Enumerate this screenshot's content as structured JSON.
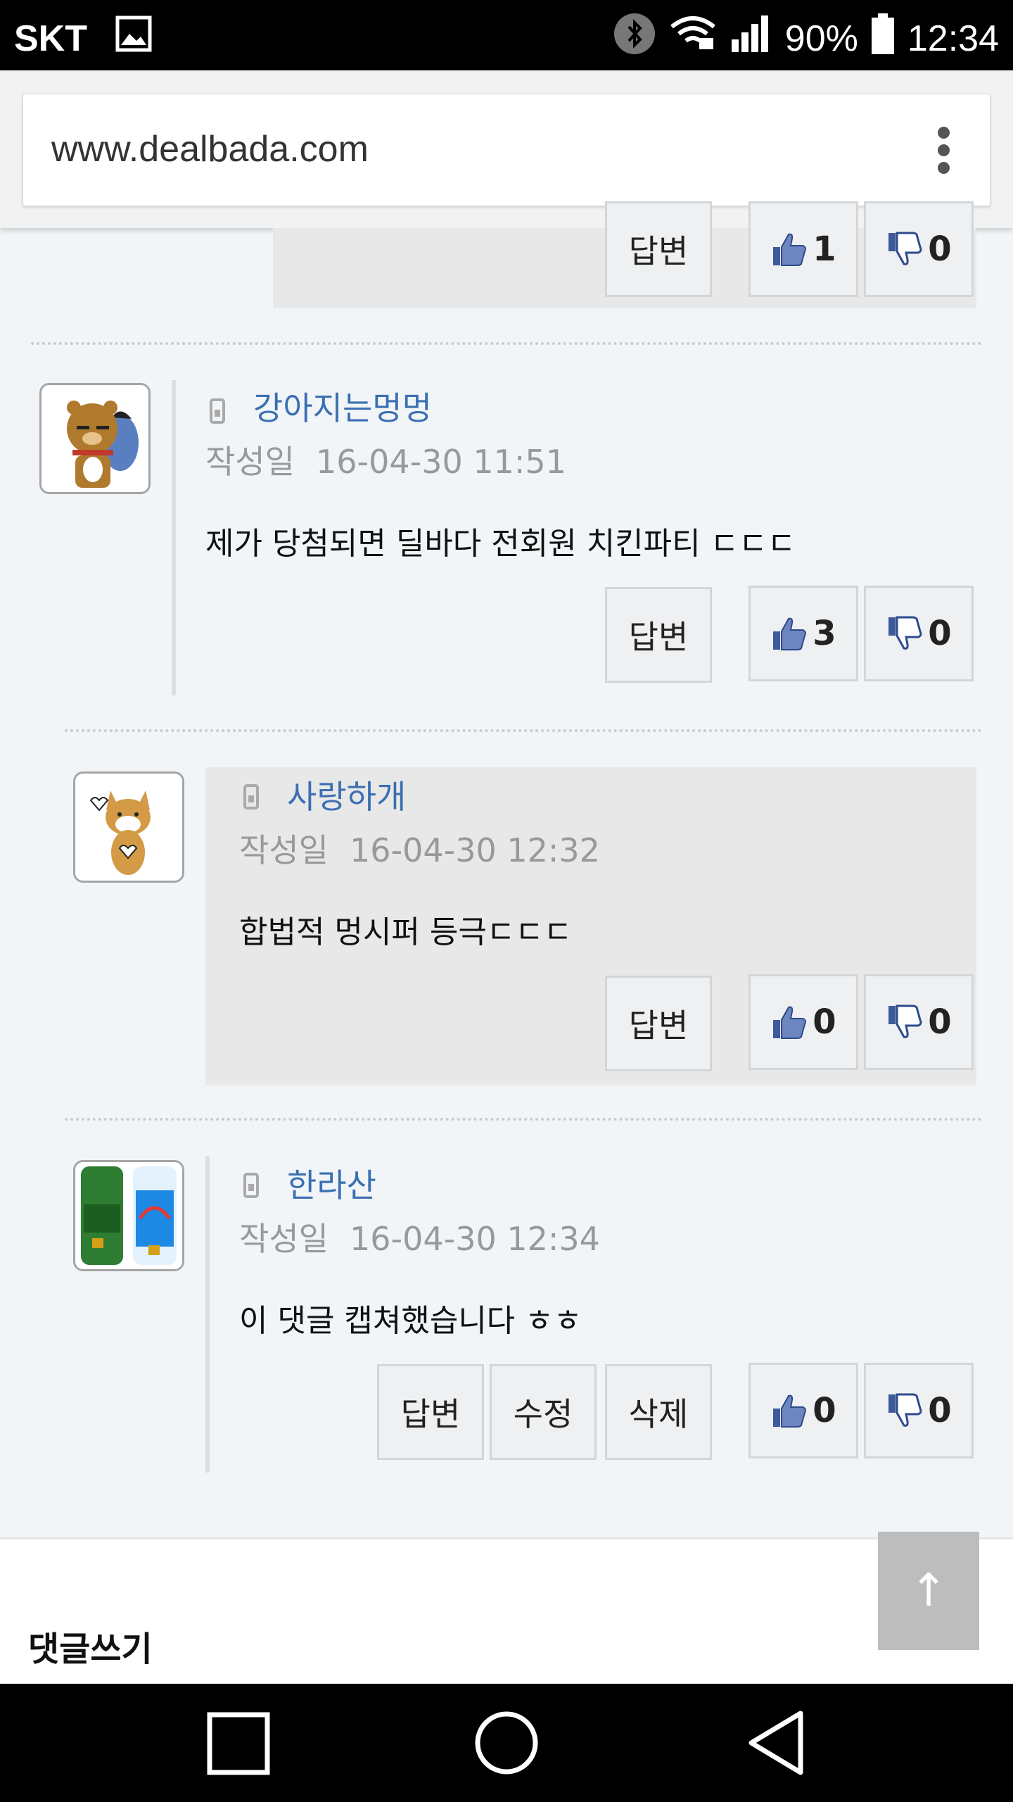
{
  "status": {
    "carrier": "SKT",
    "battery": "90%",
    "time": "12:34"
  },
  "browser": {
    "url": "www.dealbada.com"
  },
  "labels": {
    "written": "작성일",
    "reply": "답변",
    "edit": "수정",
    "delete": "삭제"
  },
  "prev_comment": {
    "likes": "1",
    "dislikes": "0"
  },
  "comments": [
    {
      "author": "강아지는멍멍",
      "date": "16-04-30 11:51",
      "text": "제가 당첨되면 딜바다 전회원 치킨파티 ㄷㄷㄷ",
      "likes": "3",
      "dislikes": "0"
    },
    {
      "author": "사랑하개",
      "date": "16-04-30 12:32",
      "text": "합법적 멍시퍼 등극ㄷㄷㄷ",
      "likes": "0",
      "dislikes": "0"
    },
    {
      "author": "한라산",
      "date": "16-04-30 12:34",
      "text": "이 댓글 캡쳐했습니다 ㅎㅎ",
      "likes": "0",
      "dislikes": "0"
    }
  ],
  "footer": {
    "write_title": "댓글쓰기",
    "top_arrow": "↑"
  },
  "colors": {
    "author": "#3b6fb2",
    "background": "#f1f5f8",
    "reply_box": "#e8e8e8"
  }
}
